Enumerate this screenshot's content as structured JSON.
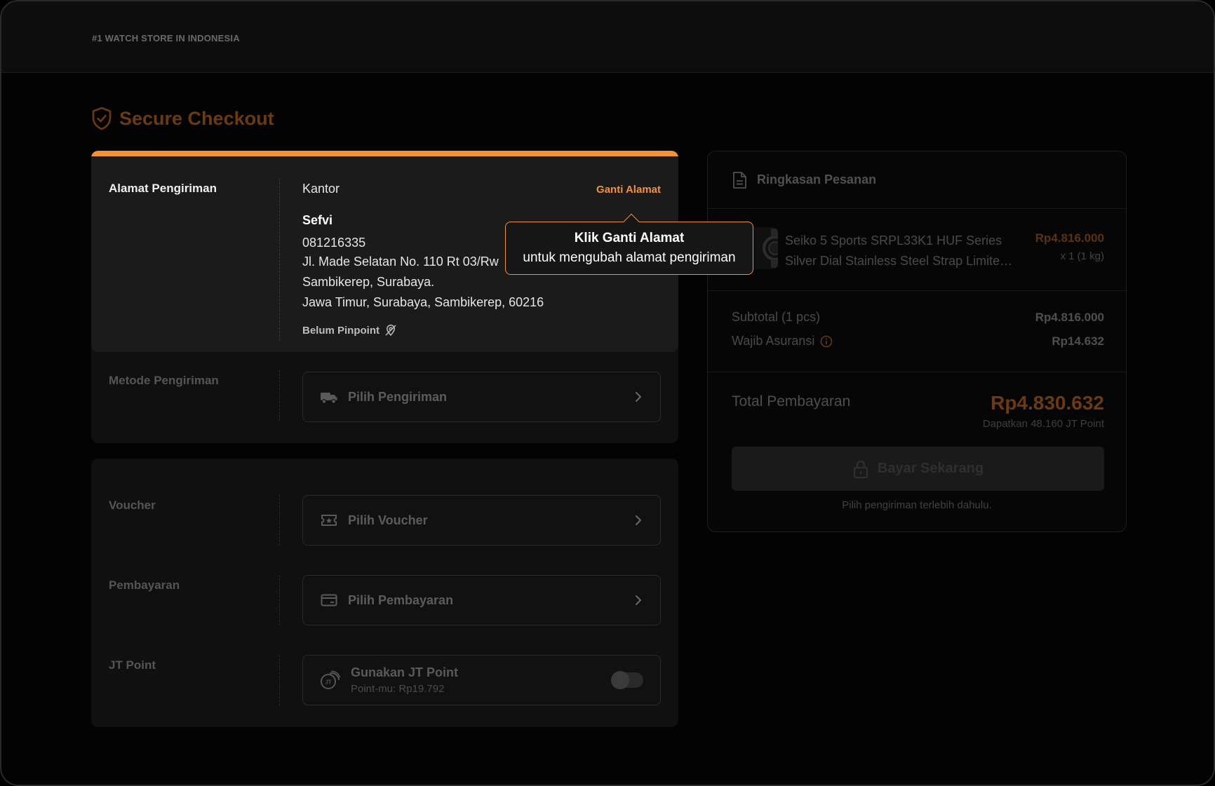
{
  "header": {
    "tagline": "#1 WATCH STORE IN INDONESIA"
  },
  "page": {
    "title": "Secure Checkout"
  },
  "address": {
    "section_label": "Alamat Pengiriman",
    "type": "Kantor",
    "change_label": "Ganti Alamat",
    "name": "Sefvi",
    "phone": "081216335",
    "line1": "Jl. Made Selatan No. 110 Rt 03/Rw",
    "line2": "Sambikerep, Surabaya.",
    "line3": "Jawa Timur, Surabaya, Sambikerep, 60216",
    "pin_status": "Belum Pinpoint"
  },
  "tooltip": {
    "line1": "Klik Ganti Alamat",
    "line2": "untuk mengubah alamat pengiriman"
  },
  "shipping": {
    "section_label": "Metode Pengiriman",
    "select_label": "Pilih Pengiriman"
  },
  "voucher": {
    "section_label": "Voucher",
    "select_label": "Pilih Voucher"
  },
  "payment": {
    "section_label": "Pembayaran",
    "select_label": "Pilih Pembayaran"
  },
  "jt_point": {
    "section_label": "JT Point",
    "title": "Gunakan JT Point",
    "subtitle": "Point-mu: Rp19.792",
    "enabled": false
  },
  "summary": {
    "title": "Ringkasan Pesanan",
    "product": {
      "name_line1": "Seiko 5 Sports SRPL33K1 HUF Series",
      "name_line2": "Silver Dial Stainless Steel Strap Limited Edition",
      "price": "Rp4.816.000",
      "qty": "x 1 (1 kg)"
    },
    "subtotal_label": "Subtotal (1 pcs)",
    "subtotal_value": "Rp4.816.000",
    "insurance_label": "Wajib Asuransi",
    "insurance_value": "Rp14.632",
    "total_label": "Total Pembayaran",
    "total_value": "Rp4.830.632",
    "points_earned": "Dapatkan 48.160 JT Point",
    "pay_button": "Bayar Sekarang",
    "pay_hint": "Pilih pengiriman terlebih dahulu."
  },
  "colors": {
    "accent": "#f0923a",
    "background": "#030303",
    "card": "#1b1b1b"
  }
}
